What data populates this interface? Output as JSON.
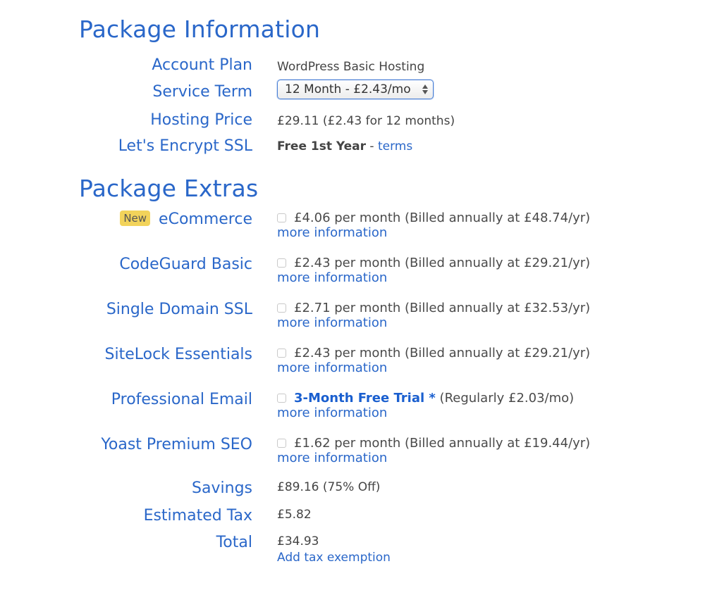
{
  "package_information": {
    "title": "Package Information",
    "rows": {
      "account_plan": {
        "label": "Account Plan",
        "value": "WordPress Basic Hosting"
      },
      "service_term": {
        "label": "Service Term",
        "selected": "12 Month - £2.43/mo"
      },
      "hosting_price": {
        "label": "Hosting Price",
        "value": "£29.11 (£2.43 for 12 months)"
      },
      "ssl": {
        "label": "Let's Encrypt SSL",
        "value": "Free 1st Year",
        "separator": " - ",
        "link": "terms"
      }
    }
  },
  "package_extras": {
    "title": "Package Extras",
    "badge": "New",
    "more_info_label": "more information",
    "items": [
      {
        "label": "eCommerce",
        "price": "£4.06 per month (Billed annually at £48.74/yr)",
        "checked": false
      },
      {
        "label": "CodeGuard Basic",
        "price": "£2.43 per month (Billed annually at £29.21/yr)",
        "checked": false
      },
      {
        "label": "Single Domain SSL",
        "price": "£2.71 per month (Billed annually at £32.53/yr)",
        "checked": false
      },
      {
        "label": "SiteLock Essentials",
        "price": "£2.43 per month (Billed annually at £29.21/yr)",
        "checked": false
      },
      {
        "label": "Professional Email",
        "trial": "3-Month Free Trial *",
        "price": " (Regularly £2.03/mo)",
        "checked": false
      },
      {
        "label": "Yoast Premium SEO",
        "price": "£1.62 per month (Billed annually at £19.44/yr)",
        "checked": false
      }
    ]
  },
  "summary": {
    "savings": {
      "label": "Savings",
      "value": "£89.16 (75% Off)"
    },
    "tax": {
      "label": "Estimated Tax",
      "value": "£5.82"
    },
    "total": {
      "label": "Total",
      "value": "£34.93",
      "link": "Add tax exemption"
    }
  }
}
